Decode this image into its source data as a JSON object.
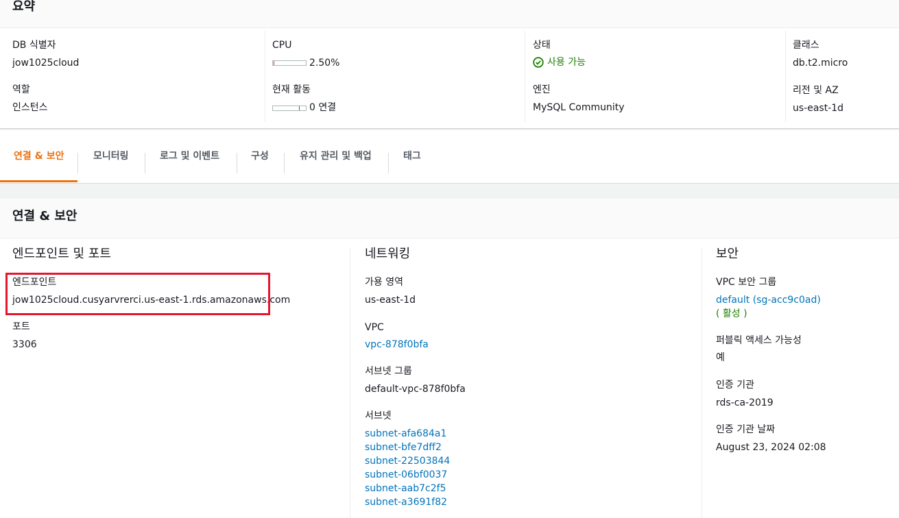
{
  "summary": {
    "title": "요약",
    "db_identifier": {
      "label": "DB 식별자",
      "value": "jow1025cloud"
    },
    "role": {
      "label": "역할",
      "value": "인스턴스"
    },
    "cpu": {
      "label": "CPU",
      "value": "2.50%",
      "level_percent": 2.5
    },
    "activity": {
      "label": "현재 활동",
      "value": "0 연결",
      "level_percent": 0
    },
    "status": {
      "label": "상태",
      "value": "사용 가능",
      "color": "#1d8102"
    },
    "engine": {
      "label": "엔진",
      "value": "MySQL Community"
    },
    "class": {
      "label": "클래스",
      "value": "db.t2.micro"
    },
    "region": {
      "label": "리전 및 AZ",
      "value": "us-east-1d"
    }
  },
  "tabs": [
    {
      "label": "연결 & 보안",
      "active": true
    },
    {
      "label": "모니터링"
    },
    {
      "label": "로그 및 이벤트"
    },
    {
      "label": "구성"
    },
    {
      "label": "유지 관리 및 백업"
    },
    {
      "label": "태그"
    }
  ],
  "section": {
    "title": "연결 & 보안"
  },
  "endpoint": {
    "title": "엔드포인트 및 포트",
    "endpoint_label": "엔드포인트",
    "endpoint_value": "jow1025cloud.cusyarvrerci.us-east-1.rds.amazonaws.com",
    "port_label": "포트",
    "port_value": "3306"
  },
  "networking": {
    "title": "네트워킹",
    "az_label": "가용 영역",
    "az_value": "us-east-1d",
    "vpc_label": "VPC",
    "vpc_value": "vpc-878f0bfa",
    "subnet_group_label": "서브넷 그룹",
    "subnet_group_value": "default-vpc-878f0bfa",
    "subnets_label": "서브넷",
    "subnets": [
      "subnet-afa684a1",
      "subnet-bfe7dff2",
      "subnet-22503844",
      "subnet-06bf0037",
      "subnet-aab7c2f5",
      "subnet-a3691f82"
    ]
  },
  "security": {
    "title": "보안",
    "sg_label": "VPC 보안 그룹",
    "sg_value": "default (sg-acc9c0ad)",
    "sg_status": "( 활성 )",
    "public_label": "퍼블릭 액세스 가능성",
    "public_value": "예",
    "ca_label": "인증 기관",
    "ca_value": "rds-ca-2019",
    "ca_date_label": "인증 기관 날짜",
    "ca_date_value": "August 23, 2024 02:08"
  },
  "colors": {
    "accent": "#ec7211",
    "link": "#0073bb",
    "success": "#1d8102",
    "highlight": "#e5152d"
  }
}
